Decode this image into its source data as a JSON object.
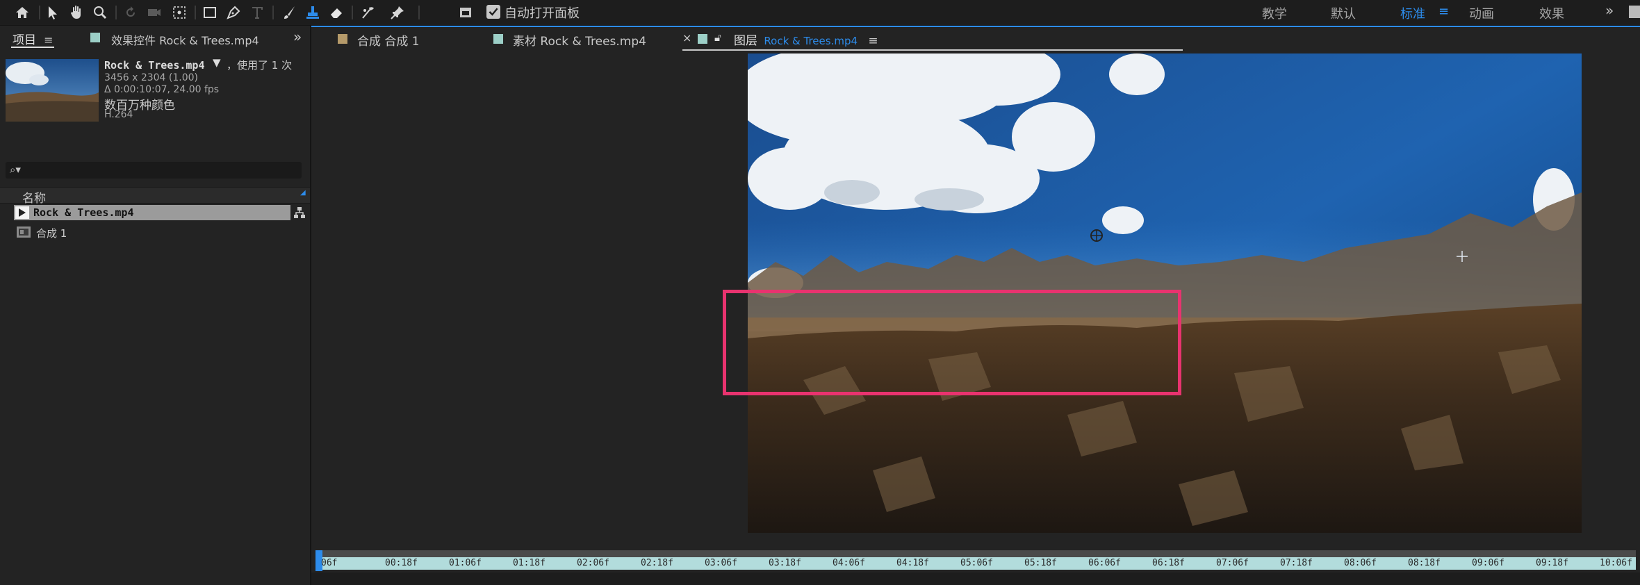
{
  "toolbar": {
    "tools": [
      "home-icon",
      "selection-icon",
      "hand-icon",
      "zoom-icon",
      "rotate-icon",
      "camera-icon",
      "anchor-icon",
      "rectangle-icon",
      "pen-icon",
      "text-icon",
      "brush-icon",
      "clone-stamp-icon",
      "eraser-icon",
      "roto-brush-icon",
      "puppet-pin-icon"
    ],
    "auto_open_label": "自动打开面板",
    "workspaces": [
      "教学",
      "默认",
      "标准",
      "动画",
      "效果"
    ],
    "active_workspace": "标准"
  },
  "project_panel": {
    "tab_project": "项目",
    "tab_effects": "效果控件 Rock & Trees.mp4",
    "file_name": "Rock & Trees.mp4",
    "used_text": "，使用了 1 次",
    "dimensions": "3456 x 2304 (1.00)",
    "duration": "Δ 0:00:10:07, 24.00 fps",
    "colors": "数百万种颜色",
    "codec": "H.264",
    "search_placeholder": "",
    "column_name": "名称",
    "items": [
      {
        "label": "Rock & Trees.mp4",
        "type": "footage"
      },
      {
        "label": "合成 1",
        "type": "composition"
      }
    ]
  },
  "viewer_tabs": {
    "comp_tab": "合成 合成 1",
    "footage_tab": "素材 Rock & Trees.mp4",
    "layer_tab_prefix": "图层",
    "layer_tab_name": "Rock & Trees.mp4"
  },
  "timeline": {
    "ticks": [
      "06f",
      "00:18f",
      "01:06f",
      "01:18f",
      "02:06f",
      "02:18f",
      "03:06f",
      "03:18f",
      "04:06f",
      "04:18f",
      "05:06f",
      "05:18f",
      "06:06f",
      "06:18f",
      "07:06f",
      "07:18f",
      "08:06f",
      "08:18f",
      "09:06f",
      "09:18f",
      "10:06f"
    ]
  },
  "colors": {
    "accent": "#2d8ceb",
    "highlight_box": "#e8336f",
    "comp_swatch": "#b59a6a",
    "footage_swatch": "#9ccfc7"
  }
}
